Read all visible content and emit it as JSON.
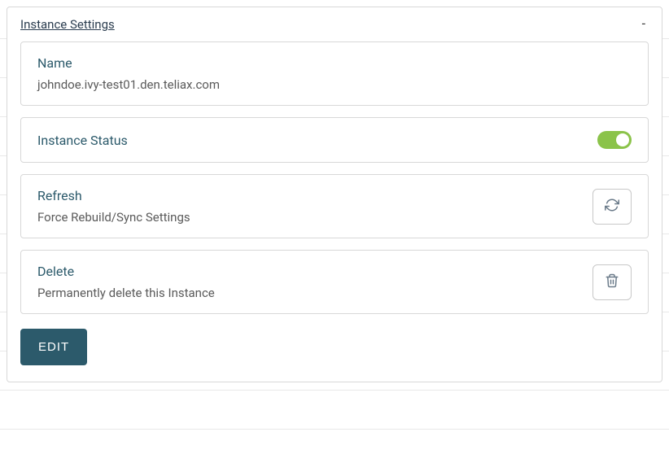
{
  "panel": {
    "title": "Instance Settings",
    "collapse_symbol": "-"
  },
  "name_card": {
    "label": "Name",
    "value": "johndoe.ivy-test01.den.teliax.com"
  },
  "status_card": {
    "label": "Instance Status",
    "toggle_on": true
  },
  "refresh_card": {
    "label": "Refresh",
    "description": "Force Rebuild/Sync Settings"
  },
  "delete_card": {
    "label": "Delete",
    "description": "Permanently delete this Instance"
  },
  "actions": {
    "edit_label": "EDIT"
  }
}
